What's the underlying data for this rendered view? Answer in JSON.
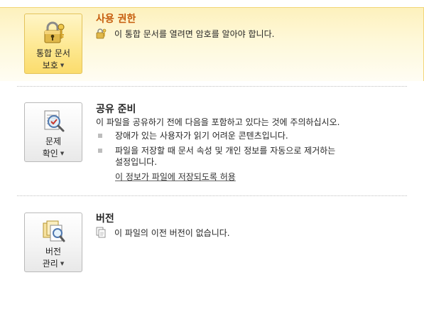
{
  "permissions": {
    "button_line1": "통합 문서",
    "button_line2": "보호",
    "title": "사용 권한",
    "description": "이 통합 문서를 열려면 암호를 알아야 합니다.",
    "title_color": "#c65c0c",
    "icon": "lock-key-icon"
  },
  "prepare": {
    "button_line1": "문제",
    "button_line2": "확인",
    "title": "공유 준비",
    "intro": "이 파일을 공유하기 전에 다음을 포함하고 있다는 것에 주의하십시오.",
    "bullets": [
      "장애가 있는 사용자가 읽기 어려운 콘텐츠입니다.",
      "파일을 저장할 때 문서 속성 및 개인 정보를 자동으로 제거하는 설정입니다."
    ],
    "bullet2_line1": "파일을 저장할 때 문서 속성 및 개인 정보를 자동으로 제거하는",
    "bullet2_line2": "설정입니다.",
    "link": "이 정보가 파일에 저장되도록 허용",
    "icon": "checklist-inspect-icon"
  },
  "versions": {
    "button_line1": "버전",
    "button_line2": "관리",
    "title": "버전",
    "description": "이 파일의 이전 버전이 없습니다.",
    "icon": "versions-icon"
  }
}
